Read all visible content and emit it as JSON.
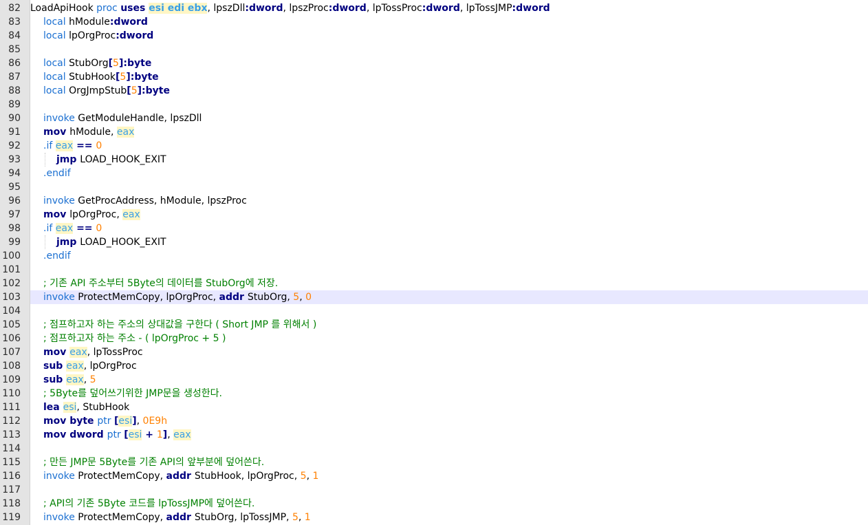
{
  "editor": {
    "colors": {
      "gutter_bg": "#e4e4e4",
      "current_line_bg": "#e8e8ff",
      "keyword": "#1a6fd1",
      "instruction": "#000080",
      "register": "#3aa0e6",
      "number": "#ff8000",
      "comment": "#008000"
    },
    "current_line": 103,
    "lines": [
      {
        "n": "82",
        "indent": 0,
        "tokens": [
          [
            "plain",
            "LoadApiHook "
          ],
          [
            "kw",
            "proc "
          ],
          [
            "instr",
            "uses "
          ],
          [
            "reg",
            "esi edi ebx"
          ],
          [
            "plain",
            ", lpszDll"
          ],
          [
            "type",
            ":dword"
          ],
          [
            "plain",
            ", lpszProc"
          ],
          [
            "type",
            ":dword"
          ],
          [
            "plain",
            ", lpTossProc"
          ],
          [
            "type",
            ":dword"
          ],
          [
            "plain",
            ", lpTossJMP"
          ],
          [
            "type",
            ":dword"
          ]
        ]
      },
      {
        "n": "83",
        "indent": 1,
        "tokens": [
          [
            "kw",
            "local "
          ],
          [
            "plain",
            "hModule"
          ],
          [
            "type",
            ":dword"
          ]
        ]
      },
      {
        "n": "84",
        "indent": 1,
        "tokens": [
          [
            "kw",
            "local "
          ],
          [
            "plain",
            "lpOrgProc"
          ],
          [
            "type",
            ":dword"
          ]
        ]
      },
      {
        "n": "85",
        "indent": 0,
        "tokens": []
      },
      {
        "n": "86",
        "indent": 1,
        "tokens": [
          [
            "kw",
            "local "
          ],
          [
            "plain",
            "StubOrg"
          ],
          [
            "op",
            "["
          ],
          [
            "num",
            "5"
          ],
          [
            "op",
            "]"
          ],
          [
            "type",
            ":byte"
          ]
        ]
      },
      {
        "n": "87",
        "indent": 1,
        "tokens": [
          [
            "kw",
            "local "
          ],
          [
            "plain",
            "StubHook"
          ],
          [
            "op",
            "["
          ],
          [
            "num",
            "5"
          ],
          [
            "op",
            "]"
          ],
          [
            "type",
            ":byte"
          ]
        ]
      },
      {
        "n": "88",
        "indent": 1,
        "tokens": [
          [
            "kw",
            "local "
          ],
          [
            "plain",
            "OrgJmpStub"
          ],
          [
            "op",
            "["
          ],
          [
            "num",
            "5"
          ],
          [
            "op",
            "]"
          ],
          [
            "type",
            ":byte"
          ]
        ]
      },
      {
        "n": "89",
        "indent": 0,
        "tokens": []
      },
      {
        "n": "90",
        "indent": 1,
        "tokens": [
          [
            "kw",
            "invoke "
          ],
          [
            "plain",
            "GetModuleHandle, lpszDll"
          ]
        ]
      },
      {
        "n": "91",
        "indent": 1,
        "tokens": [
          [
            "instr",
            "mov "
          ],
          [
            "plain",
            "hModule, "
          ],
          [
            "regnb",
            "eax"
          ]
        ]
      },
      {
        "n": "92",
        "indent": 1,
        "tokens": [
          [
            "dir",
            ".if "
          ],
          [
            "regnb",
            "eax"
          ],
          [
            "op",
            " == "
          ],
          [
            "num",
            "0"
          ]
        ]
      },
      {
        "n": "93",
        "indent": 2,
        "tokens": [
          [
            "instr",
            "jmp "
          ],
          [
            "plain",
            "LOAD_HOOK_EXIT"
          ]
        ]
      },
      {
        "n": "94",
        "indent": 1,
        "tokens": [
          [
            "dir",
            ".endif"
          ]
        ]
      },
      {
        "n": "95",
        "indent": 0,
        "tokens": []
      },
      {
        "n": "96",
        "indent": 1,
        "tokens": [
          [
            "kw",
            "invoke "
          ],
          [
            "plain",
            "GetProcAddress, hModule, lpszProc"
          ]
        ]
      },
      {
        "n": "97",
        "indent": 1,
        "tokens": [
          [
            "instr",
            "mov "
          ],
          [
            "plain",
            "lpOrgProc, "
          ],
          [
            "regnb",
            "eax"
          ]
        ]
      },
      {
        "n": "98",
        "indent": 1,
        "tokens": [
          [
            "dir",
            ".if "
          ],
          [
            "regnb",
            "eax"
          ],
          [
            "op",
            " == "
          ],
          [
            "num",
            "0"
          ]
        ]
      },
      {
        "n": "99",
        "indent": 2,
        "tokens": [
          [
            "instr",
            "jmp "
          ],
          [
            "plain",
            "LOAD_HOOK_EXIT"
          ]
        ]
      },
      {
        "n": "100",
        "indent": 1,
        "tokens": [
          [
            "dir",
            ".endif"
          ]
        ]
      },
      {
        "n": "101",
        "indent": 0,
        "tokens": []
      },
      {
        "n": "102",
        "indent": 1,
        "tokens": [
          [
            "comment",
            "; 기존 API 주소부터 5Byte의 데이터를 StubOrg에 저장."
          ]
        ]
      },
      {
        "n": "103",
        "indent": 1,
        "tokens": [
          [
            "kw",
            "invoke "
          ],
          [
            "plain",
            "ProtectMemCopy, lpOrgProc, "
          ],
          [
            "instr",
            "addr "
          ],
          [
            "plain",
            "StubOrg, "
          ],
          [
            "num",
            "5"
          ],
          [
            "plain",
            ", "
          ],
          [
            "num",
            "0"
          ]
        ]
      },
      {
        "n": "104",
        "indent": 0,
        "tokens": []
      },
      {
        "n": "105",
        "indent": 1,
        "tokens": [
          [
            "comment",
            "; 점프하고자 하는 주소의 상대값을 구한다 ( Short JMP 를 위해서 )"
          ]
        ]
      },
      {
        "n": "106",
        "indent": 1,
        "tokens": [
          [
            "comment",
            "; 점프하고자 하는 주소 - ( lpOrgProc + 5 )"
          ]
        ]
      },
      {
        "n": "107",
        "indent": 1,
        "tokens": [
          [
            "instr",
            "mov "
          ],
          [
            "regnb",
            "eax"
          ],
          [
            "plain",
            ", lpTossProc"
          ]
        ]
      },
      {
        "n": "108",
        "indent": 1,
        "tokens": [
          [
            "instr",
            "sub "
          ],
          [
            "regnb",
            "eax"
          ],
          [
            "plain",
            ", lpOrgProc"
          ]
        ]
      },
      {
        "n": "109",
        "indent": 1,
        "tokens": [
          [
            "instr",
            "sub "
          ],
          [
            "regnb",
            "eax"
          ],
          [
            "plain",
            ", "
          ],
          [
            "num",
            "5"
          ]
        ]
      },
      {
        "n": "110",
        "indent": 1,
        "tokens": [
          [
            "comment",
            "; 5Byte를 덮어쓰기위한 JMP문을 생성한다."
          ]
        ]
      },
      {
        "n": "111",
        "indent": 1,
        "tokens": [
          [
            "instr",
            "lea "
          ],
          [
            "regnb",
            "esi"
          ],
          [
            "plain",
            ", StubHook"
          ]
        ]
      },
      {
        "n": "112",
        "indent": 1,
        "tokens": [
          [
            "instr",
            "mov byte "
          ],
          [
            "kw",
            "ptr "
          ],
          [
            "op",
            "["
          ],
          [
            "regnb",
            "esi"
          ],
          [
            "op",
            "]"
          ],
          [
            "plain",
            ", "
          ],
          [
            "num",
            "0E9h"
          ]
        ]
      },
      {
        "n": "113",
        "indent": 1,
        "tokens": [
          [
            "instr",
            "mov dword "
          ],
          [
            "kw",
            "ptr "
          ],
          [
            "op",
            "["
          ],
          [
            "regnb",
            "esi"
          ],
          [
            "op",
            " + "
          ],
          [
            "num",
            "1"
          ],
          [
            "op",
            "]"
          ],
          [
            "plain",
            ", "
          ],
          [
            "regnb",
            "eax"
          ]
        ]
      },
      {
        "n": "114",
        "indent": 0,
        "tokens": []
      },
      {
        "n": "115",
        "indent": 1,
        "tokens": [
          [
            "comment",
            "; 만든 JMP문 5Byte를 기존 API의 앞부분에 덮어쓴다."
          ]
        ]
      },
      {
        "n": "116",
        "indent": 1,
        "tokens": [
          [
            "kw",
            "invoke "
          ],
          [
            "plain",
            "ProtectMemCopy, "
          ],
          [
            "instr",
            "addr "
          ],
          [
            "plain",
            "StubHook, lpOrgProc, "
          ],
          [
            "num",
            "5"
          ],
          [
            "plain",
            ", "
          ],
          [
            "num",
            "1"
          ]
        ]
      },
      {
        "n": "117",
        "indent": 0,
        "tokens": []
      },
      {
        "n": "118",
        "indent": 1,
        "tokens": [
          [
            "comment",
            "; API의 기존 5Byte 코드를 lpTossJMP에 덮어쓴다."
          ]
        ]
      },
      {
        "n": "119",
        "indent": 1,
        "tokens": [
          [
            "kw",
            "invoke "
          ],
          [
            "plain",
            "ProtectMemCopy, "
          ],
          [
            "instr",
            "addr "
          ],
          [
            "plain",
            "StubOrg, lpTossJMP, "
          ],
          [
            "num",
            "5"
          ],
          [
            "plain",
            ", "
          ],
          [
            "num",
            "1"
          ]
        ]
      }
    ]
  }
}
